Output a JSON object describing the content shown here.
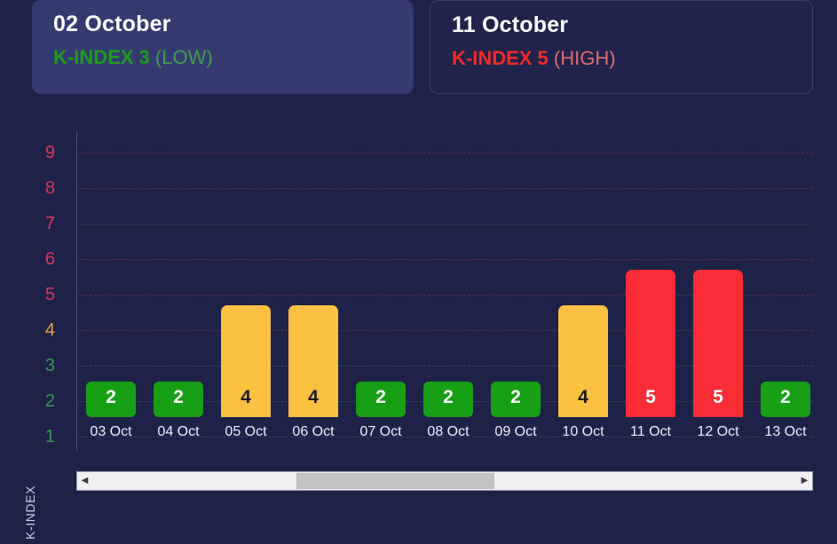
{
  "cards": [
    {
      "date": "02 October",
      "k_prefix": "K-INDEX 3",
      "k_level": "(LOW)",
      "style": "filled",
      "level_class": "low",
      "accent": "#1c9c1c"
    },
    {
      "date": "11 October",
      "k_prefix": "K-INDEX 5",
      "k_level": "(HIGH)",
      "style": "outlined",
      "level_class": "high",
      "accent": "#f32a2a"
    }
  ],
  "chart_data": {
    "type": "bar",
    "title": "",
    "xlabel": "",
    "ylabel": "K-INDEX",
    "ylim": [
      0,
      9
    ],
    "yticks": [
      9,
      8,
      7,
      6,
      5,
      4,
      3,
      2,
      1
    ],
    "ytick_colors": [
      "#d93a5c",
      "#d93a5c",
      "#d93a5c",
      "#d93a5c",
      "#d93a5c",
      "#e8a33c",
      "#2f9e52",
      "#2f9e52",
      "#2f9e52"
    ],
    "grid": true,
    "legend": "none",
    "categories": [
      "03 Oct",
      "04 Oct",
      "05 Oct",
      "06 Oct",
      "07 Oct",
      "08 Oct",
      "09 Oct",
      "10 Oct",
      "11 Oct",
      "12 Oct",
      "13 Oct"
    ],
    "values": [
      2,
      2,
      4,
      4,
      2,
      2,
      2,
      4,
      5,
      5,
      2
    ],
    "bar_levels": [
      "low",
      "low",
      "moderate",
      "moderate",
      "low",
      "low",
      "low",
      "moderate",
      "high",
      "high",
      "low"
    ],
    "colors": {
      "low": "#16a016",
      "moderate": "#fbc040",
      "high": "#fa2d37",
      "low_text": "#ffffff",
      "moderate_text": "#1a1a1a",
      "high_text": "#ffffff"
    }
  },
  "scrollbar": {
    "left_arrow": "◀",
    "right_arrow": "▶"
  },
  "theme": {
    "background": "#1e2148",
    "card_filled": "#353a70",
    "card_outline": "#3b3f68",
    "axis_line": "#4a4f80",
    "axis_label": "#c9cde8",
    "xlabel": "#eef0fa"
  }
}
